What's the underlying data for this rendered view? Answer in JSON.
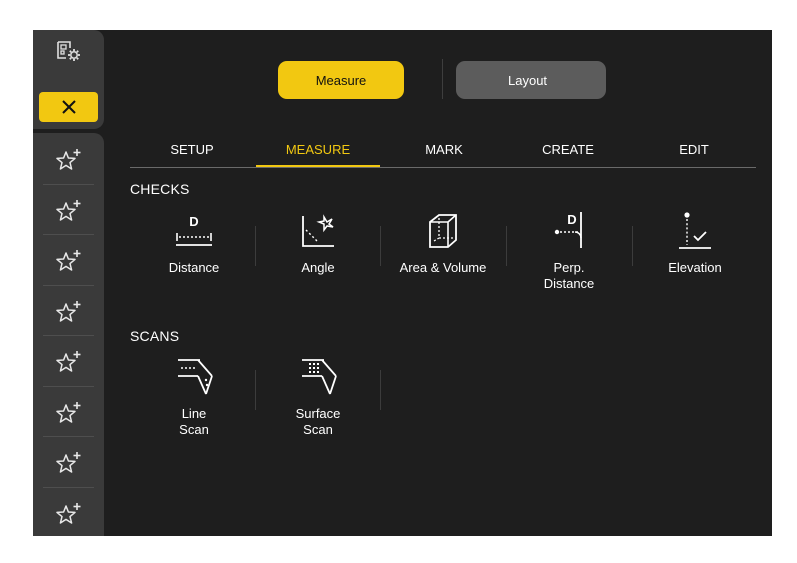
{
  "sidebar": {
    "settings_icon": "settings-panel-icon",
    "close_icon": "close-icon",
    "favorites_icon": "star-plus-icon",
    "favorites_count": 8
  },
  "mode_toggle": {
    "measure_label": "Measure",
    "layout_label": "Layout",
    "active": "Measure"
  },
  "tabs": [
    {
      "label": "SETUP"
    },
    {
      "label": "MEASURE"
    },
    {
      "label": "MARK"
    },
    {
      "label": "CREATE"
    },
    {
      "label": "EDIT"
    }
  ],
  "active_tab": "MEASURE",
  "sections": {
    "checks": {
      "title": "CHECKS",
      "tools": [
        {
          "label": "Distance",
          "icon": "distance-icon",
          "badge": "D"
        },
        {
          "label": "Angle",
          "icon": "angle-icon"
        },
        {
          "label": "Area & Volume",
          "icon": "area-volume-icon"
        },
        {
          "label": "Perp.\nDistance",
          "icon": "perp-distance-icon",
          "badge": "D"
        },
        {
          "label": "Elevation",
          "icon": "elevation-icon"
        }
      ]
    },
    "scans": {
      "title": "SCANS",
      "tools": [
        {
          "label": "Line\nScan",
          "icon": "line-scan-icon"
        },
        {
          "label": "Surface\nScan",
          "icon": "surface-scan-icon"
        }
      ]
    }
  },
  "colors": {
    "accent": "#f2c811",
    "background": "#1e1e1e",
    "sidebar": "#3a3a3a",
    "inactive_button": "#5c5c5c"
  }
}
